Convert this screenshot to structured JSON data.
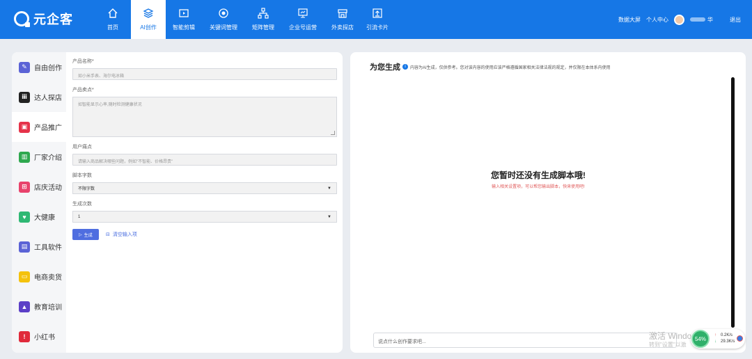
{
  "brand": {
    "name": "元企客"
  },
  "nav": {
    "items": [
      {
        "label": "首页",
        "icon": "home-icon",
        "active": false
      },
      {
        "label": "AI创作",
        "icon": "layers-icon",
        "active": true
      },
      {
        "label": "智能剪辑",
        "icon": "video-icon",
        "active": false
      },
      {
        "label": "关键词管理",
        "icon": "target-icon",
        "active": false
      },
      {
        "label": "矩阵管理",
        "icon": "org-chart-icon",
        "active": false
      },
      {
        "label": "企业号运营",
        "icon": "presentation-icon",
        "active": false
      },
      {
        "label": "外卖探店",
        "icon": "store-icon",
        "active": false
      },
      {
        "label": "引流卡片",
        "icon": "upload-card-icon",
        "active": false
      }
    ],
    "right": {
      "data_screen": "数据大屏",
      "personal_center": "个人中心",
      "user_name_suffix": "华",
      "logout": "退出"
    }
  },
  "categories": [
    {
      "label": "自由创作",
      "icon": "edit-icon",
      "color": "#5b63d6",
      "active": false
    },
    {
      "label": "达人探店",
      "icon": "dianping-icon",
      "color": "#222222",
      "active": false
    },
    {
      "label": "产品推广",
      "icon": "box-icon",
      "color": "#e5334a",
      "active": true
    },
    {
      "label": "厂家介绍",
      "icon": "building-icon",
      "color": "#2fa84f",
      "active": false
    },
    {
      "label": "店庆活动",
      "icon": "gift-icon",
      "color": "#e8436c",
      "active": false
    },
    {
      "label": "大健康",
      "icon": "heart-icon",
      "color": "#2fb874",
      "active": false
    },
    {
      "label": "工具软件",
      "icon": "window-icon",
      "color": "#5b63d6",
      "active": false
    },
    {
      "label": "电商卖货",
      "icon": "cart-icon",
      "color": "#f4c20d",
      "active": false
    },
    {
      "label": "教育培训",
      "icon": "graduation-icon",
      "color": "#5b3fc7",
      "active": false
    },
    {
      "label": "小红书",
      "icon": "xiaohongshu-icon",
      "color": "#e02a3b",
      "active": false
    }
  ],
  "form": {
    "product_name": {
      "label": "产品名称*",
      "placeholder": "如小米手表、海尔电冰箱"
    },
    "selling_points": {
      "label": "产品卖点*",
      "placeholder": "如智能显示心率,随时检测健康状况"
    },
    "user_pain": {
      "label": "用户痛点",
      "placeholder": "请输入商品解决哪些问题，例如\"不智能、价格昂贵\""
    },
    "word_count": {
      "label": "脚本字数",
      "value": "不限字数"
    },
    "gen_count": {
      "label": "生成次数",
      "value": "1"
    },
    "generate_button": "生成",
    "clear_link": "清空输入项"
  },
  "result": {
    "title": "为您生成",
    "note": "内容为AI生成，仅供参考。您对该内容的使用应该严格遵循国家相关法律法规的规定，并仅限在本体系内使用",
    "empty_title": "您暂时还没有生成脚本哦!",
    "empty_sub": "输入相关设置项，可以帮您输出脚本，快来使用吧!",
    "prompt_placeholder": "说点什么创作要求吧..."
  },
  "overlay": {
    "watermark": "激活 Windo",
    "watermark_sub": "转到\"设置\"以激",
    "net_percent": "54%",
    "net_up": "0.2K/s",
    "net_down": "29.3K/s"
  }
}
